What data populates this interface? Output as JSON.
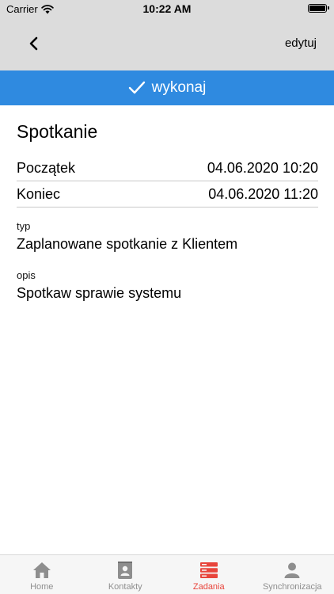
{
  "status": {
    "carrier": "Carrier",
    "time": "10:22 AM"
  },
  "nav": {
    "edit_label": "edytuj"
  },
  "action": {
    "label": "wykonaj"
  },
  "task": {
    "title": "Spotkanie",
    "start_label": "Początek",
    "start_value": "04.06.2020 10:20",
    "end_label": "Koniec",
    "end_value": "04.06.2020 11:20",
    "type_label": "typ",
    "type_value": "Zaplanowane spotkanie z Klientem",
    "desc_label": "opis",
    "desc_value": "Spotkaw sprawie systemu"
  },
  "tabs": [
    {
      "label": "Home",
      "icon": "home-icon"
    },
    {
      "label": "Kontakty",
      "icon": "contacts-icon"
    },
    {
      "label": "Zadania",
      "icon": "tasks-icon",
      "active": true
    },
    {
      "label": "Synchronizacja",
      "icon": "person-icon"
    }
  ],
  "colors": {
    "accent": "#2f8ae0",
    "active_tab": "#e8453c",
    "inactive_tab": "#8e8e8e"
  }
}
